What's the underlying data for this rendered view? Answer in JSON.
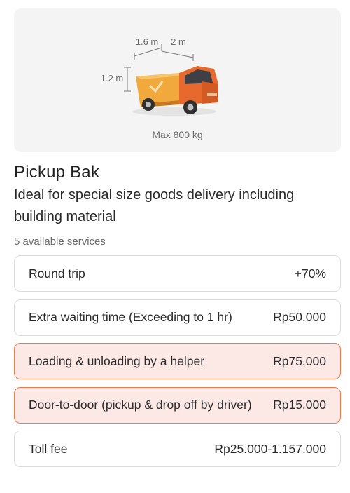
{
  "vehicle": {
    "name": "Pickup Bak",
    "description": "Ideal for special size goods delivery including building material",
    "dimensions": {
      "width": "1.6 m",
      "length": "2 m",
      "height": "1.2 m"
    },
    "max_load": "Max 800 kg",
    "colors": {
      "body": "#f0a93a",
      "cab": "#e8692e",
      "card_bg": "#f4f4f4"
    },
    "icon": "pickup-truck-icon"
  },
  "services": {
    "count_label": "5 available services",
    "selected_color": "#fce9e6",
    "selected_border": "#ee7a4e",
    "items": [
      {
        "label": "Round trip",
        "price": "+70%",
        "selected": false
      },
      {
        "label": "Extra waiting time (Exceeding to 1 hr)",
        "price": "Rp50.000",
        "selected": false
      },
      {
        "label": "Loading & unloading by a helper",
        "price": "Rp75.000",
        "selected": true
      },
      {
        "label": "Door-to-door (pickup & drop off by driver)",
        "price": "Rp15.000",
        "selected": true
      },
      {
        "label": "Toll fee",
        "price": "Rp25.000-1.157.000",
        "selected": false
      }
    ]
  }
}
